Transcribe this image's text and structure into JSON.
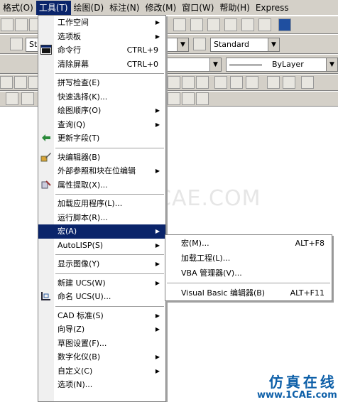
{
  "menubar": {
    "items": [
      "格式(O)",
      "工具(T)",
      "绘图(D)",
      "标注(N)",
      "修改(M)",
      "窗口(W)",
      "帮助(H)",
      "Express"
    ]
  },
  "toolbar": {
    "text_style": "Standard",
    "linetype": "ByLayer",
    "style_partial": "St"
  },
  "watermark": "1CAE.COM",
  "logo": {
    "line1": "仿真在线",
    "line2": "www.1CAE.com"
  },
  "tools_menu": {
    "items": [
      {
        "label": "工作空间",
        "submenu": true
      },
      {
        "label": "选项板",
        "submenu": true
      },
      {
        "label": "命令行",
        "shortcut": "CTRL+9",
        "icon": "command-line-icon"
      },
      {
        "label": "清除屏幕",
        "shortcut": "CTRL+0"
      },
      {
        "sep": true
      },
      {
        "label": "拼写检查(E)"
      },
      {
        "label": "快速选择(K)..."
      },
      {
        "label": "绘图顺序(O)",
        "submenu": true
      },
      {
        "label": "查询(Q)",
        "submenu": true
      },
      {
        "label": "更新字段(T)",
        "icon": "update-field-icon"
      },
      {
        "sep": true
      },
      {
        "label": "块编辑器(B)",
        "icon": "block-editor-icon"
      },
      {
        "label": "外部参照和块在位编辑",
        "submenu": true
      },
      {
        "label": "属性提取(X)...",
        "icon": "attribute-extract-icon"
      },
      {
        "sep": true
      },
      {
        "label": "加载应用程序(L)..."
      },
      {
        "label": "运行脚本(R)..."
      },
      {
        "label": "宏(A)",
        "submenu": true,
        "highlighted": true
      },
      {
        "label": "AutoLISP(S)",
        "submenu": true
      },
      {
        "sep": true
      },
      {
        "label": "显示图像(Y)",
        "submenu": true
      },
      {
        "sep": true
      },
      {
        "label": "新建 UCS(W)",
        "submenu": true
      },
      {
        "label": "命名 UCS(U)...",
        "icon": "named-ucs-icon"
      },
      {
        "sep": true
      },
      {
        "label": "CAD 标准(S)",
        "submenu": true
      },
      {
        "label": "向导(Z)",
        "submenu": true
      },
      {
        "label": "草图设置(F)..."
      },
      {
        "label": "数字化仪(B)",
        "submenu": true
      },
      {
        "label": "自定义(C)",
        "submenu": true
      },
      {
        "label": "选项(N)..."
      }
    ]
  },
  "macro_menu": {
    "items": [
      {
        "label": "宏(M)...",
        "shortcut": "ALT+F8"
      },
      {
        "label": "加载工程(L)..."
      },
      {
        "label": "VBA 管理器(V)..."
      },
      {
        "sep": true
      },
      {
        "label": "Visual Basic 编辑器(B)",
        "shortcut": "ALT+F11"
      }
    ]
  }
}
